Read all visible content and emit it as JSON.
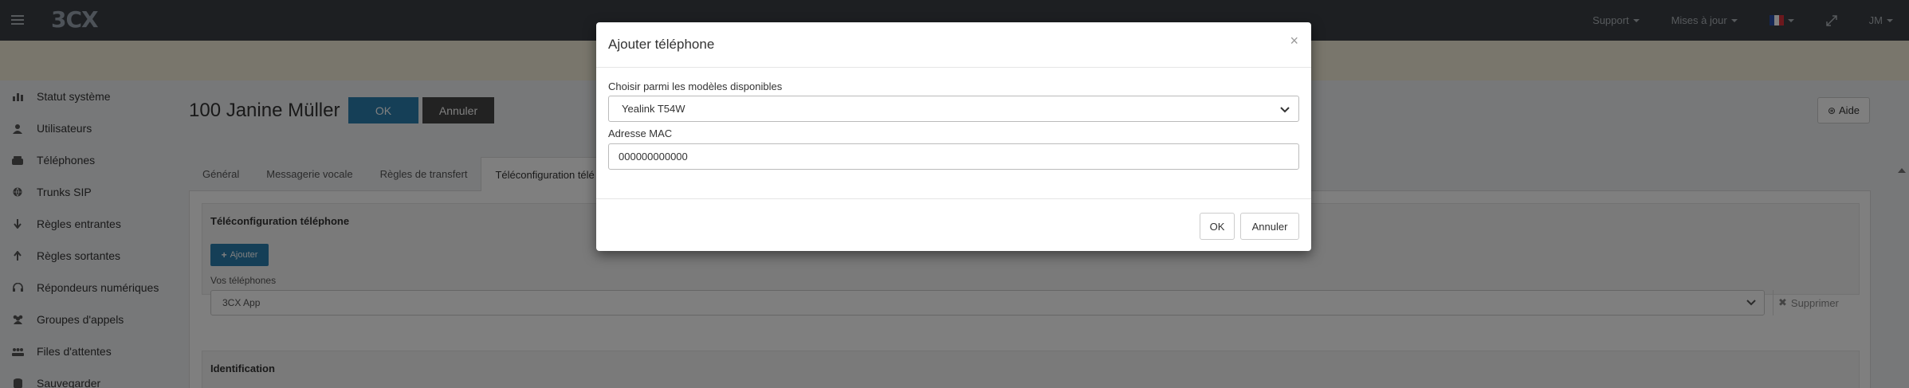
{
  "topbar": {
    "logo": "3CX",
    "support_label": "Support",
    "updates_label": "Mises à jour",
    "user_initials": "JM",
    "flag_colors": [
      "#2a4ea8",
      "#ffffff",
      "#d9303a"
    ]
  },
  "sidebar": {
    "items": [
      {
        "label": "Statut système",
        "icon": "bar-chart-icon"
      },
      {
        "label": "Utilisateurs",
        "icon": "user-icon"
      },
      {
        "label": "Téléphones",
        "icon": "phone-icon"
      },
      {
        "label": "Trunks SIP",
        "icon": "globe-icon"
      },
      {
        "label": "Règles entrantes",
        "icon": "arrow-down-icon"
      },
      {
        "label": "Règles sortantes",
        "icon": "arrow-up-icon"
      },
      {
        "label": "Répondeurs numériques",
        "icon": "headset-icon"
      },
      {
        "label": "Groupes d'appels",
        "icon": "users-icon"
      },
      {
        "label": "Files d'attentes",
        "icon": "queue-icon"
      },
      {
        "label": "Sauvegarder",
        "icon": "database-icon"
      }
    ]
  },
  "main": {
    "title": "100 Janine Müller",
    "ok_label": "OK",
    "cancel_label": "Annuler",
    "help_label": "Aide",
    "tabs": [
      "Général",
      "Messagerie vocale",
      "Règles de transfert",
      "Téléconfiguration télé"
    ],
    "provision": {
      "title": "Téléconfiguration téléphone",
      "add_label": "Ajouter",
      "phones_label": "Vos téléphones",
      "phones_value": "3CX App",
      "delete_label": "Supprimer"
    },
    "identification_title": "Identification"
  },
  "modal": {
    "title": "Ajouter téléphone",
    "close_glyph": "×",
    "model_label": "Choisir parmi les modèles disponibles",
    "model_value": "Yealink T54W",
    "mac_label": "Adresse MAC",
    "mac_value": "000000000000",
    "ok_label": "OK",
    "cancel_label": "Annuler"
  },
  "colors": {
    "primary": "#2a7fae",
    "topbar": "#3a3f44",
    "strip": "#f3ecd8"
  }
}
